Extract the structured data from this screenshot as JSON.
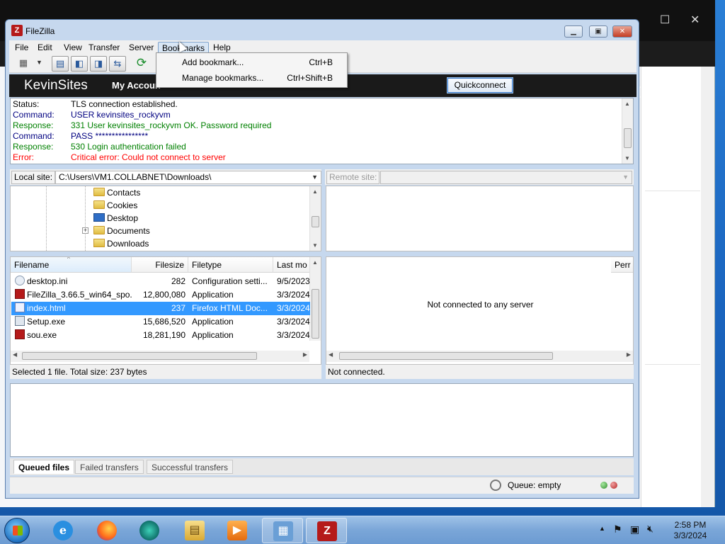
{
  "window": {
    "title": "FileZilla",
    "logo_letter": "Z"
  },
  "menu": {
    "file": "File",
    "edit": "Edit",
    "view": "View",
    "transfer": "Transfer",
    "server": "Server",
    "bookmarks": "Bookmarks",
    "help": "Help"
  },
  "bookmarks_menu": {
    "items": [
      {
        "label": "Add bookmark...",
        "shortcut": "Ctrl+B"
      },
      {
        "label": "Manage bookmarks...",
        "shortcut": "Ctrl+Shift+B"
      }
    ]
  },
  "quickconnect_bar": {
    "brand": "KevinSites",
    "my_account": "My Accoun",
    "quickconnect_button": "Quickconnect"
  },
  "message_log": [
    {
      "type": "Status:",
      "text": "TLS connection established.",
      "color": "#000000"
    },
    {
      "type": "Command:",
      "text": "USER kevinsites_rockyvm",
      "color": "#000080"
    },
    {
      "type": "Response:",
      "text": "331 User kevinsites_rockyvm OK. Password required",
      "color": "#008000"
    },
    {
      "type": "Command:",
      "text": "PASS ****************",
      "color": "#000080"
    },
    {
      "type": "Response:",
      "text": "530 Login authentication failed",
      "color": "#008000"
    },
    {
      "type": "Error:",
      "text": "Critical error: Could not connect to server",
      "color": "#ff0000"
    }
  ],
  "local": {
    "site_label": "Local site:",
    "path": "C:\\Users\\VM1.COLLABNET\\Downloads\\",
    "tree": [
      {
        "name": "Contacts",
        "icon": "folder-icon"
      },
      {
        "name": "Cookies",
        "icon": "folder-icon"
      },
      {
        "name": "Desktop",
        "icon": "desktop-icon"
      },
      {
        "name": "Documents",
        "icon": "folder-icon",
        "expandable": true
      },
      {
        "name": "Downloads",
        "icon": "downloads-icon"
      }
    ],
    "columns": {
      "filename": "Filename",
      "filesize": "Filesize",
      "filetype": "Filetype",
      "last_modified": "Last mo"
    },
    "files": [
      {
        "name": "desktop.ini",
        "size": "282",
        "type": "Configuration setti...",
        "modified": "9/5/2023",
        "icon": "config-file-icon"
      },
      {
        "name": "FileZilla_3.66.5_win64_spo...",
        "size": "12,800,080",
        "type": "Application",
        "modified": "3/3/2024",
        "icon": "filezilla-app-icon"
      },
      {
        "name": "index.html",
        "size": "237",
        "type": "Firefox HTML Doc...",
        "modified": "3/3/2024",
        "icon": "html-file-icon",
        "selected": true
      },
      {
        "name": "Setup.exe",
        "size": "15,686,520",
        "type": "Application",
        "modified": "3/3/2024",
        "icon": "setup-app-icon"
      },
      {
        "name": "sou.exe",
        "size": "18,281,190",
        "type": "Application",
        "modified": "3/3/2024",
        "icon": "filezilla-app-icon"
      }
    ],
    "status": "Selected 1 file. Total size: 237 bytes"
  },
  "remote": {
    "site_label": "Remote site:",
    "path": "",
    "column_perm": "Perr",
    "empty_message": "Not connected to any server",
    "status": "Not connected."
  },
  "queue": {
    "tabs": [
      "Queued files",
      "Failed transfers",
      "Successful transfers"
    ],
    "active_tab": 0,
    "queue_status": "Queue: empty"
  },
  "taskbar": {
    "apps": [
      {
        "name": "internet-explorer",
        "glyph": "e"
      },
      {
        "name": "firefox",
        "glyph": "●"
      },
      {
        "name": "chrome-like",
        "glyph": "●"
      },
      {
        "name": "file-explorer",
        "glyph": "▤"
      },
      {
        "name": "media-player",
        "glyph": "▶"
      },
      {
        "name": "control-panel",
        "glyph": "▦"
      },
      {
        "name": "filezilla",
        "glyph": "Z"
      }
    ],
    "time": "2:58 PM",
    "date": "3/3/2024"
  },
  "colors": {
    "selection": "#3399ff",
    "filezilla_red": "#b51a1a",
    "quickbar_bg": "#1a1a1a"
  }
}
